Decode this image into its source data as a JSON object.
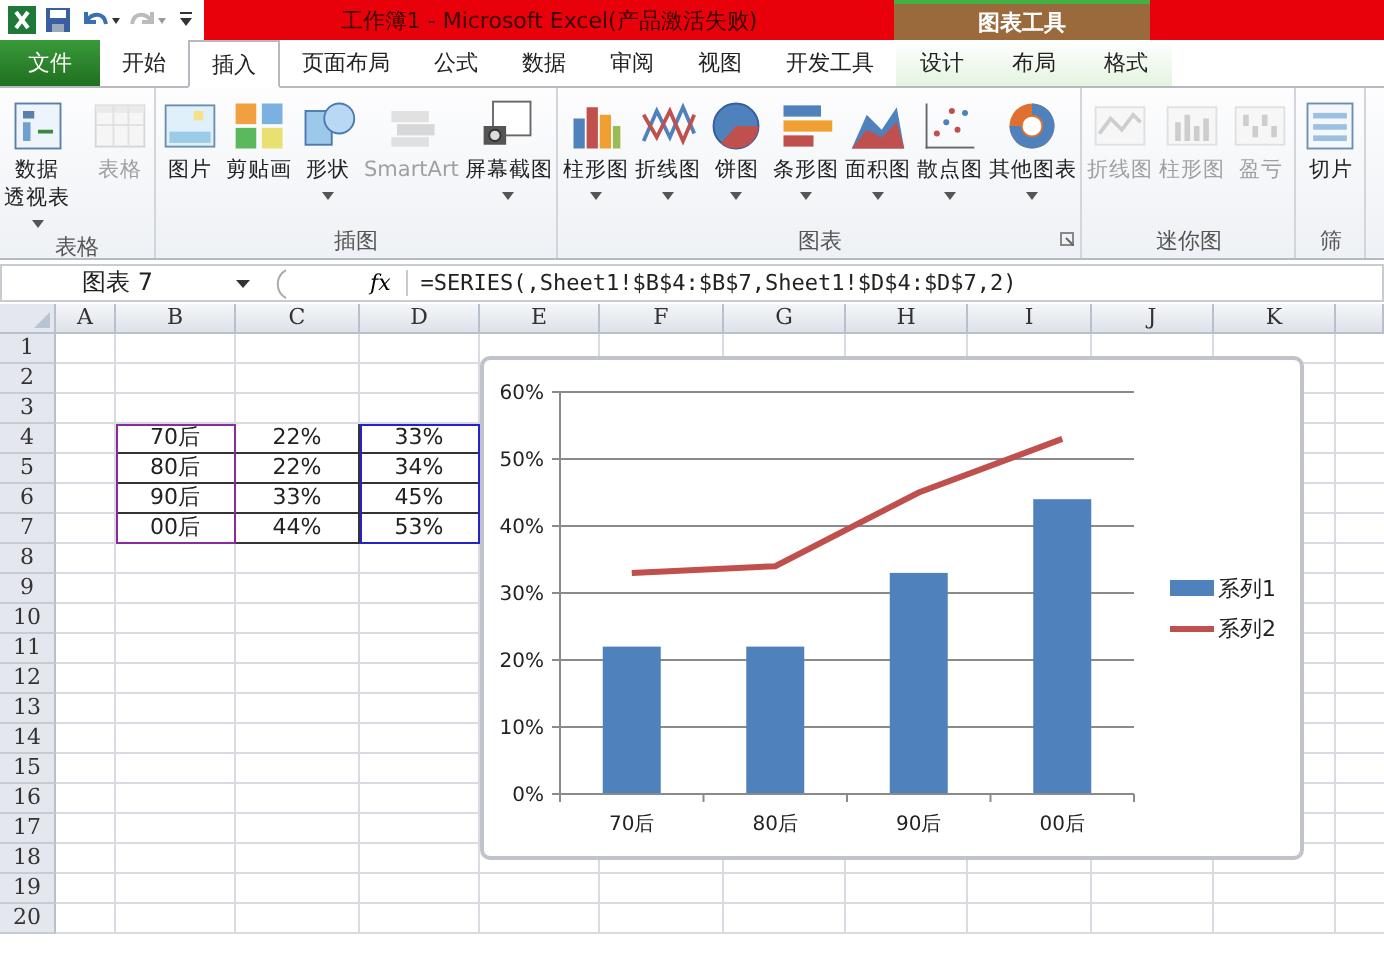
{
  "window": {
    "title": "工作簿1  -  Microsoft Excel(产品激活失败)",
    "context_title": "图表工具"
  },
  "tabs": [
    {
      "label": "文件",
      "kind": "file",
      "selected": false
    },
    {
      "label": "开始",
      "kind": "normal",
      "selected": false
    },
    {
      "label": "插入",
      "kind": "normal",
      "selected": true
    },
    {
      "label": "页面布局",
      "kind": "normal",
      "selected": false
    },
    {
      "label": "公式",
      "kind": "normal",
      "selected": false
    },
    {
      "label": "数据",
      "kind": "normal",
      "selected": false
    },
    {
      "label": "审阅",
      "kind": "normal",
      "selected": false
    },
    {
      "label": "视图",
      "kind": "normal",
      "selected": false
    },
    {
      "label": "开发工具",
      "kind": "normal",
      "selected": false
    },
    {
      "label": "设计",
      "kind": "context",
      "selected": false
    },
    {
      "label": "布局",
      "kind": "context",
      "selected": false
    },
    {
      "label": "格式",
      "kind": "context",
      "selected": false
    }
  ],
  "ribbon": [
    {
      "label": "表格",
      "buttons": [
        {
          "lines": [
            "数据",
            "透视表"
          ],
          "dropdown": true,
          "disabled": false
        },
        {
          "lines": [
            "表格"
          ],
          "dropdown": false,
          "disabled": true
        }
      ]
    },
    {
      "label": "插图",
      "buttons": [
        {
          "lines": [
            "图片"
          ],
          "dropdown": false,
          "disabled": false
        },
        {
          "lines": [
            "剪贴画"
          ],
          "dropdown": false,
          "disabled": false
        },
        {
          "lines": [
            "形状"
          ],
          "dropdown": true,
          "disabled": false
        },
        {
          "lines": [
            "SmartArt"
          ],
          "dropdown": false,
          "disabled": true
        },
        {
          "lines": [
            "屏幕截图"
          ],
          "dropdown": true,
          "disabled": false
        }
      ]
    },
    {
      "label": "图表",
      "launcher": true,
      "buttons": [
        {
          "lines": [
            "柱形图"
          ],
          "dropdown": true,
          "disabled": false
        },
        {
          "lines": [
            "折线图"
          ],
          "dropdown": true,
          "disabled": false
        },
        {
          "lines": [
            "饼图"
          ],
          "dropdown": true,
          "disabled": false
        },
        {
          "lines": [
            "条形图"
          ],
          "dropdown": true,
          "disabled": false
        },
        {
          "lines": [
            "面积图"
          ],
          "dropdown": true,
          "disabled": false
        },
        {
          "lines": [
            "散点图"
          ],
          "dropdown": true,
          "disabled": false
        },
        {
          "lines": [
            "其他图表"
          ],
          "dropdown": true,
          "disabled": false
        }
      ]
    },
    {
      "label": "迷你图",
      "buttons": [
        {
          "lines": [
            "折线图"
          ],
          "dropdown": false,
          "disabled": true
        },
        {
          "lines": [
            "柱形图"
          ],
          "dropdown": false,
          "disabled": true
        },
        {
          "lines": [
            "盈亏"
          ],
          "dropdown": false,
          "disabled": true
        }
      ]
    },
    {
      "label": "筛",
      "buttons": [
        {
          "lines": [
            "切片"
          ],
          "dropdown": false,
          "disabled": false
        }
      ]
    }
  ],
  "formula_bar": {
    "name_box": "图表 7",
    "fx": "fx",
    "formula": "=SERIES(,Sheet1!$B$4:$B$7,Sheet1!$D$4:$D$7,2)"
  },
  "sheet": {
    "columns": [
      "A",
      "B",
      "C",
      "D",
      "E",
      "F",
      "G",
      "H",
      "I",
      "J",
      "K"
    ],
    "rows": [
      "1",
      "2",
      "3",
      "4",
      "5",
      "6",
      "7",
      "8",
      "9",
      "10",
      "11",
      "12",
      "13",
      "14",
      "15",
      "16",
      "17",
      "18",
      "19",
      "20"
    ],
    "data": [
      [
        "70后",
        "22%",
        "33%"
      ],
      [
        "80后",
        "22%",
        "34%"
      ],
      [
        "90后",
        "33%",
        "45%"
      ],
      [
        "00后",
        "44%",
        "53%"
      ]
    ],
    "ref_ranges": [
      {
        "color": "#8b2a9e"
      },
      {
        "color": "#2323c8"
      }
    ]
  },
  "chart": {
    "chart_data": {
      "type": "bar",
      "categories": [
        "70后",
        "80后",
        "90后",
        "00后"
      ],
      "series": [
        {
          "name": "系列1",
          "color": "#4f81bd",
          "values": [
            0.22,
            0.22,
            0.33,
            0.44
          ]
        },
        {
          "name": "系列2",
          "type": "line",
          "color": "#c0504d",
          "values": [
            0.33,
            0.34,
            0.45,
            0.53
          ]
        }
      ],
      "ylim": [
        0,
        0.6
      ],
      "grid": true,
      "legend": true,
      "yticks": [
        {
          "value": 0,
          "label": "0%"
        },
        {
          "value": 0.1,
          "label": "10%"
        },
        {
          "value": 0.2,
          "label": "20%"
        },
        {
          "value": 0.3,
          "label": "30%"
        },
        {
          "value": 0.4,
          "label": "40%"
        },
        {
          "value": 0.5,
          "label": "50%"
        },
        {
          "value": 0.6,
          "label": "60%"
        }
      ]
    }
  }
}
